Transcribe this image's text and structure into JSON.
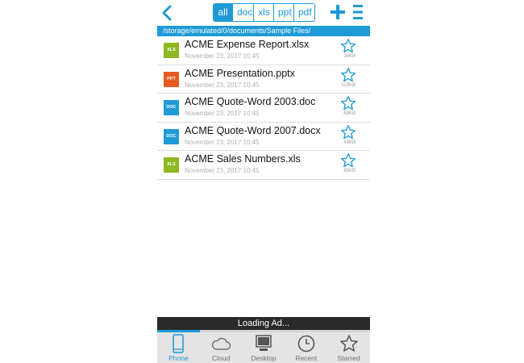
{
  "header": {
    "filters": [
      {
        "label": "all",
        "active": true
      },
      {
        "label": "doc",
        "active": false
      },
      {
        "label": "xls",
        "active": false
      },
      {
        "label": "ppt",
        "active": false
      },
      {
        "label": "pdf",
        "active": false
      }
    ]
  },
  "path": "/storage/emulated/0/documents/Sample Files/",
  "files": [
    {
      "badge": "XLS",
      "badge_color": "#8cb820",
      "name": "ACME Expense Report.xlsx",
      "date": "November 23, 2017 10:45",
      "size": "16KB"
    },
    {
      "badge": "PPT",
      "badge_color": "#ea5b21",
      "name": "ACME Presentation.pptx",
      "date": "November 23, 2017 10:45",
      "size": "119KB"
    },
    {
      "badge": "DOC",
      "badge_color": "#1e9ad6",
      "name": "ACME Quote-Word 2003.doc",
      "date": "November 23, 2017 10:45",
      "size": "69KB"
    },
    {
      "badge": "DOC",
      "badge_color": "#1e9ad6",
      "name": "ACME Quote-Word 2007.docx",
      "date": "November 23, 2017 10:45",
      "size": "43KB"
    },
    {
      "badge": "XLS",
      "badge_color": "#8cb820",
      "name": "ACME Sales Numbers.xls",
      "date": "November 23, 2017 10:45",
      "size": "85KB"
    }
  ],
  "ad": {
    "text": "Loading Ad...",
    "progress": 0.2
  },
  "nav": [
    {
      "label": "Phone",
      "icon": "phone-icon",
      "active": true
    },
    {
      "label": "Cloud",
      "icon": "cloud-icon",
      "active": false
    },
    {
      "label": "Desktop",
      "icon": "desktop-icon",
      "active": false
    },
    {
      "label": "Recent",
      "icon": "clock-icon",
      "active": false
    },
    {
      "label": "Starred",
      "icon": "star-icon",
      "active": false
    }
  ],
  "colors": {
    "accent": "#1e9ad6",
    "xls": "#8cb820",
    "ppt": "#ea5b21",
    "doc": "#1e9ad6"
  }
}
